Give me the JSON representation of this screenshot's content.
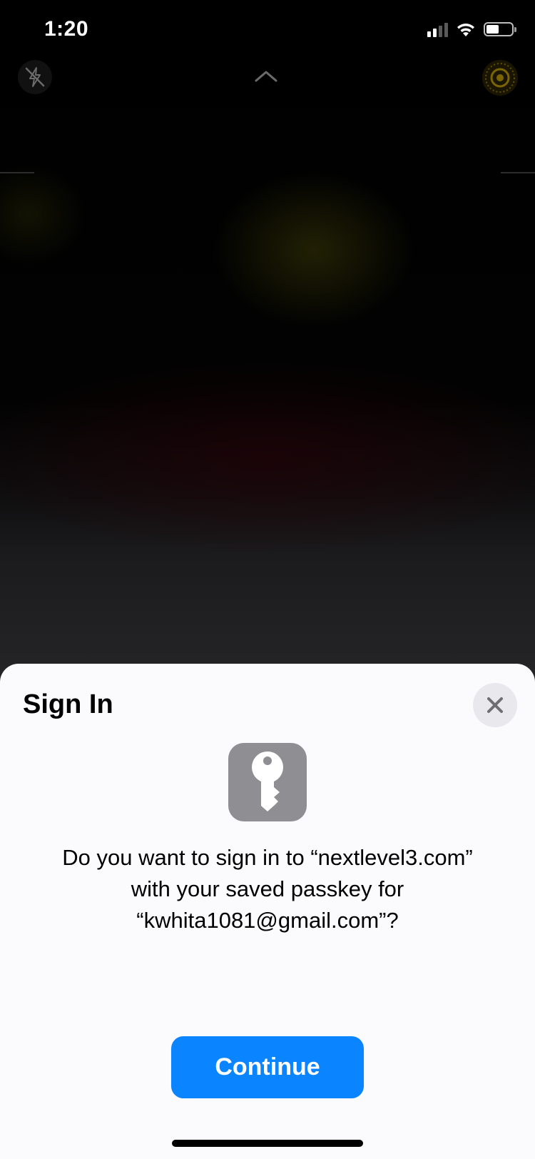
{
  "status_bar": {
    "time": "1:20",
    "signal_icon": "cellular-signal-icon",
    "wifi_icon": "wifi-icon",
    "battery_icon": "battery-icon",
    "battery_level": 0.45
  },
  "camera": {
    "flash_icon": "flash-off-icon",
    "chevron_icon": "chevron-up-icon",
    "live_icon": "live-photo-icon"
  },
  "sheet": {
    "title": "Sign In",
    "close_icon": "close-icon",
    "key_icon": "passkey-icon",
    "prompt_lines": [
      "Do you want to sign in to “nextlevel3.com”",
      "with your saved passkey for",
      "“kwhita1081@gmail.com”?"
    ],
    "continue_label": "Continue"
  },
  "colors": {
    "accent": "#0a84ff",
    "sheet_background": "#fbfbfd",
    "key_tile": "#8e8e93",
    "close_button": "#e8e8ed"
  }
}
